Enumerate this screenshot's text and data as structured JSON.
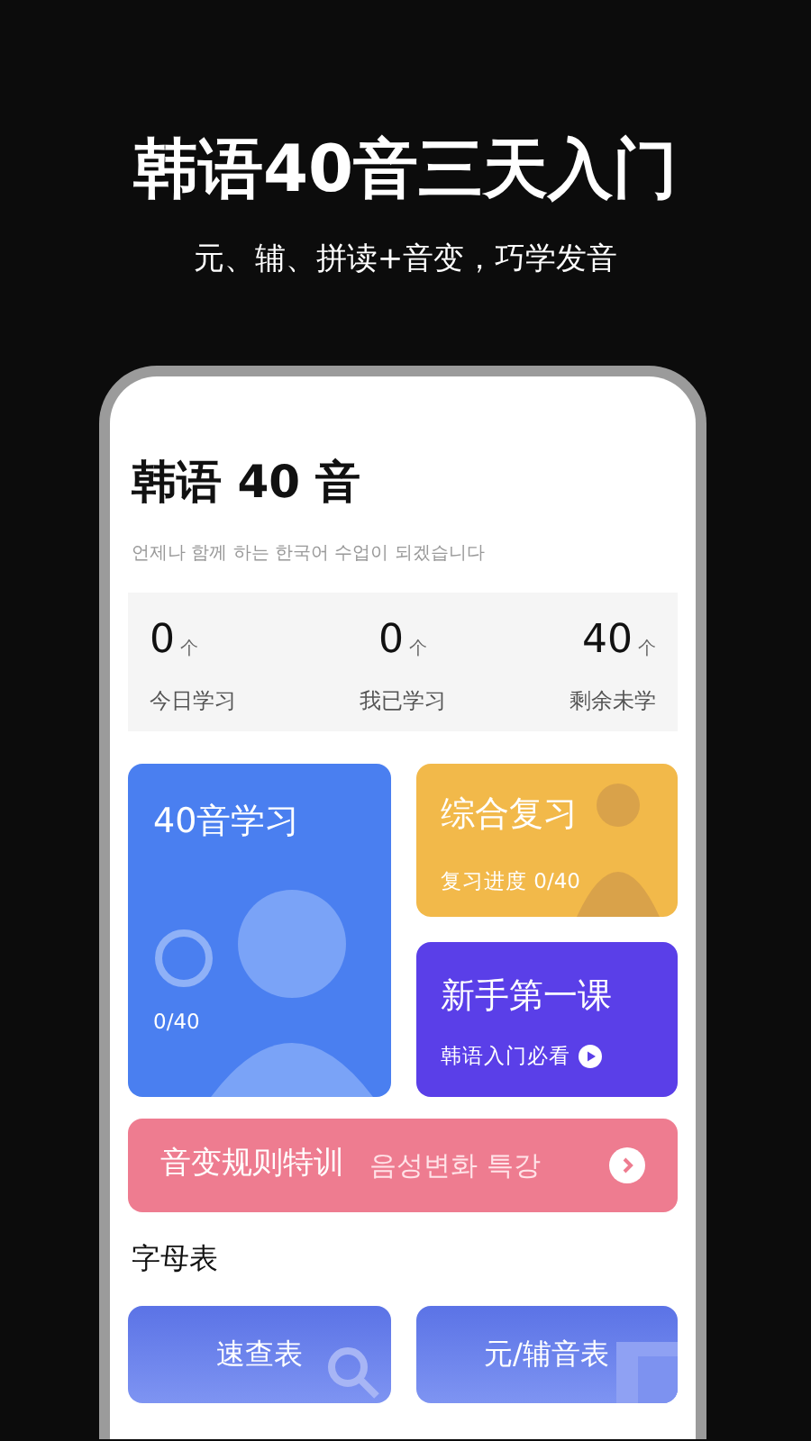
{
  "headline": "韩语40音三天入门",
  "subheadline": "元、辅、拼读+音变，巧学发音",
  "app": {
    "title": "韩语 40 音",
    "tagline": "언제나 함께  하는 한국어 수업이 되겠습니다",
    "stats": [
      {
        "value": "0",
        "unit": "个",
        "label": "今日学习"
      },
      {
        "value": "0",
        "unit": "个",
        "label": "我已学习"
      },
      {
        "value": "40",
        "unit": "个",
        "label": "剩余未学"
      }
    ],
    "cards": [
      {
        "kind": "study",
        "title": "40音学习",
        "progress": "0/40",
        "level": 0
      },
      {
        "kind": "review",
        "title": "综合复习",
        "subtitle": "复习进度 0/40"
      },
      {
        "kind": "lesson",
        "title": "新手第一课",
        "subtitle": "韩语入门必看"
      }
    ],
    "banner": {
      "title": "音变规则特训",
      "subtitle": "음성변화 특강"
    },
    "section_title": "字母表",
    "tables": [
      {
        "kind": "search",
        "label": "速查表"
      },
      {
        "kind": "grid",
        "label": "元/辅音表"
      }
    ]
  }
}
